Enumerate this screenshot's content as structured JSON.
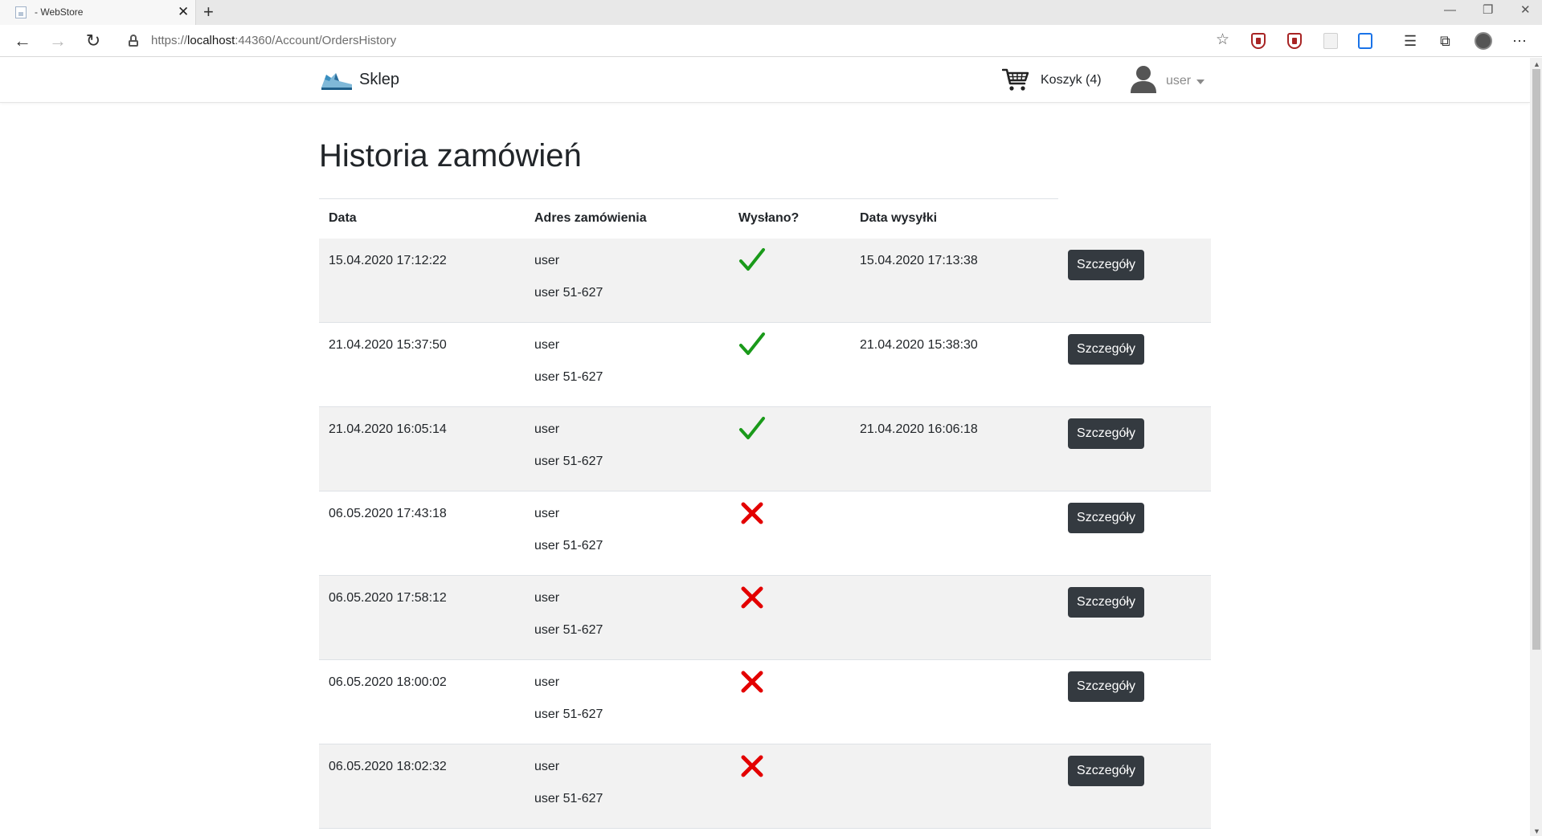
{
  "browser": {
    "tab_title": "- WebStore",
    "tab_close": "✕",
    "new_tab": "+",
    "url_prefix": "https://",
    "url_host": "localhost",
    "url_rest": ":44360/Account/OrdersHistory"
  },
  "header": {
    "brand": "Sklep",
    "cart_label": "Koszyk (4)",
    "user_label": "user"
  },
  "page": {
    "title": "Historia zamówień"
  },
  "table": {
    "columns": [
      "Data",
      "Adres zamówienia",
      "Wysłano?",
      "Data wysyłki"
    ],
    "details_label": "Szczegóły",
    "rows": [
      {
        "date": "15.04.2020 17:12:22",
        "addr_line1": "user",
        "addr_line2": "user 51-627",
        "sent": true,
        "sent_date": "15.04.2020 17:13:38"
      },
      {
        "date": "21.04.2020 15:37:50",
        "addr_line1": "user",
        "addr_line2": "user 51-627",
        "sent": true,
        "sent_date": "21.04.2020 15:38:30"
      },
      {
        "date": "21.04.2020 16:05:14",
        "addr_line1": "user",
        "addr_line2": "user 51-627",
        "sent": true,
        "sent_date": "21.04.2020 16:06:18"
      },
      {
        "date": "06.05.2020 17:43:18",
        "addr_line1": "user",
        "addr_line2": "user 51-627",
        "sent": false,
        "sent_date": ""
      },
      {
        "date": "06.05.2020 17:58:12",
        "addr_line1": "user",
        "addr_line2": "user 51-627",
        "sent": false,
        "sent_date": ""
      },
      {
        "date": "06.05.2020 18:00:02",
        "addr_line1": "user",
        "addr_line2": "user 51-627",
        "sent": false,
        "sent_date": ""
      },
      {
        "date": "06.05.2020 18:02:32",
        "addr_line1": "user",
        "addr_line2": "user 51-627",
        "sent": false,
        "sent_date": ""
      }
    ]
  },
  "colors": {
    "check": "#1a9a1a",
    "cross": "#e30000",
    "button_bg": "#343a40",
    "stripe": "#f2f2f2"
  },
  "icons": {
    "sent_true": "checkmark-icon",
    "sent_false": "cross-icon"
  }
}
